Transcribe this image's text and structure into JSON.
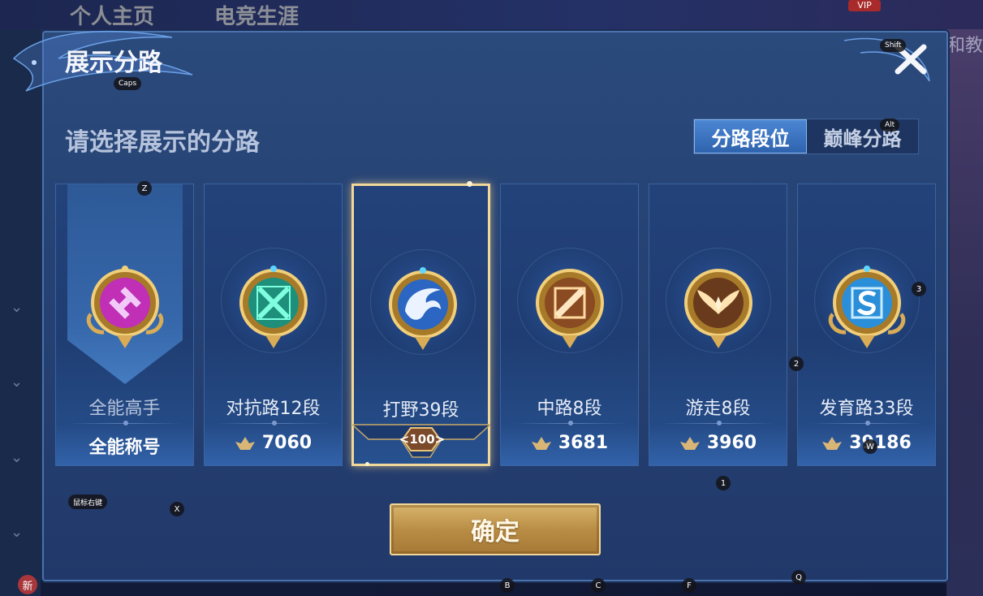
{
  "background": {
    "tabs": [
      "个人主页",
      "电竞生涯"
    ],
    "vip_label": "VIP",
    "right_text": "卖和教",
    "new_badge": "新"
  },
  "dialog": {
    "title": "展示分路",
    "close_label": "✕",
    "subtitle": "请选择展示的分路",
    "toggle": {
      "options": [
        {
          "label": "分路段位",
          "active": true
        },
        {
          "label": "巅峰分路",
          "active": false
        }
      ]
    },
    "cards": [
      {
        "lane": "全能高手",
        "score": "全能称号",
        "emblem": "all-round-emblem",
        "color": "#c02fb5",
        "selected": false,
        "show_icon": false
      },
      {
        "lane": "对抗路12段",
        "score": "7060",
        "emblem": "clash-lane-emblem",
        "color": "#2fc9a3",
        "selected": false,
        "show_icon": true
      },
      {
        "lane": "打野39段",
        "score": "",
        "rank": "100",
        "emblem": "jungle-emblem",
        "color": "#3a7ad6",
        "selected": true,
        "show_icon": false
      },
      {
        "lane": "中路8段",
        "score": "3681",
        "emblem": "mid-lane-emblem",
        "color": "#d98a3a",
        "selected": false,
        "show_icon": true
      },
      {
        "lane": "游走8段",
        "score": "3960",
        "emblem": "roam-emblem",
        "color": "#d4a04a",
        "selected": false,
        "show_icon": true
      },
      {
        "lane": "发育路33段",
        "score": "39186",
        "emblem": "farm-lane-emblem",
        "color": "#3aa6e8",
        "selected": false,
        "show_icon": true
      }
    ],
    "confirm_label": "确定"
  },
  "key_hints": [
    "Caps",
    "Shift",
    "Alt",
    "Z",
    "3",
    "2",
    "W",
    "1",
    "X",
    "鼠标右键",
    "B",
    "C",
    "F",
    "Q"
  ]
}
